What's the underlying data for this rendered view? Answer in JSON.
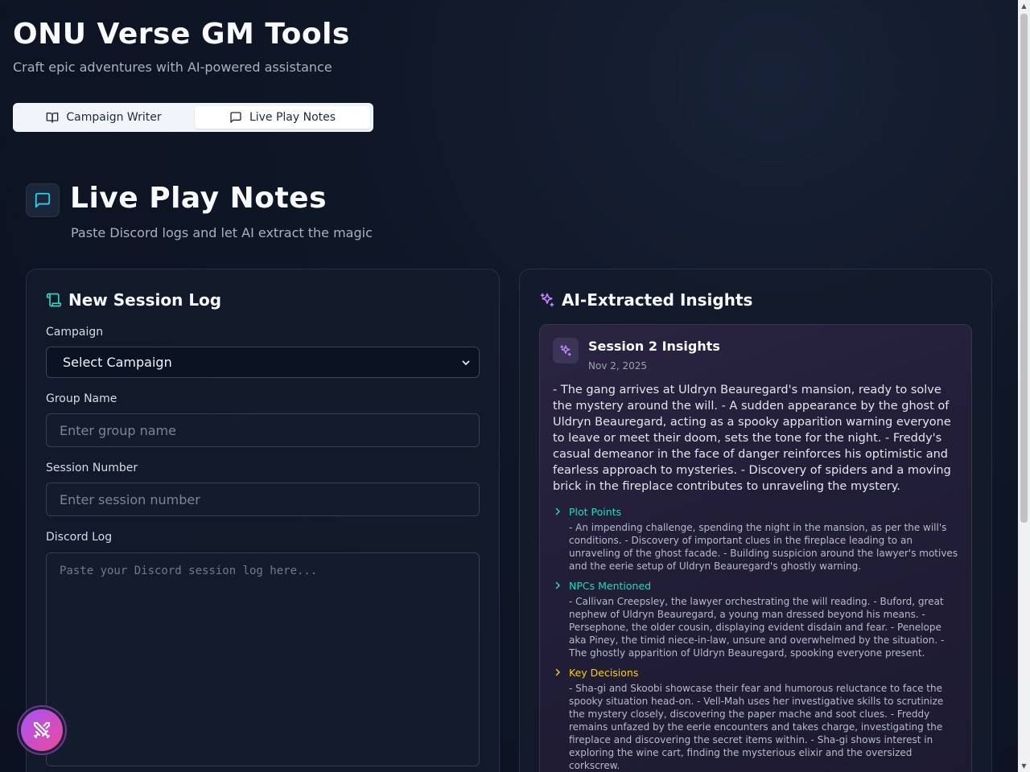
{
  "header": {
    "title": "ONU Verse GM Tools",
    "subtitle": "Craft epic adventures with AI-powered assistance"
  },
  "tabs": [
    {
      "label": "Campaign Writer",
      "icon": "book-open-icon",
      "active": false
    },
    {
      "label": "Live Play Notes",
      "icon": "message-square-icon",
      "active": true
    }
  ],
  "section": {
    "title": "Live Play Notes",
    "subtitle": "Paste Discord logs and let AI extract the magic",
    "icon": "message-square-icon"
  },
  "form": {
    "heading": "New Session Log",
    "campaign_label": "Campaign",
    "campaign_selected": "Select Campaign",
    "group_label": "Group Name",
    "group_placeholder": "Enter group name",
    "session_label": "Session Number",
    "session_placeholder": "Enter session number",
    "log_label": "Discord Log",
    "log_placeholder": "Paste your Discord session log here..."
  },
  "insights": {
    "heading": "AI-Extracted Insights",
    "card": {
      "title": "Session 2 Insights",
      "date": "Nov 2, 2025",
      "summary": "- The gang arrives at Uldryn Beauregard's mansion, ready to solve the mystery around the will. - A sudden appearance by the ghost of Uldryn Beauregard, acting as a spooky apparition warning everyone to leave or meet their doom, sets the tone for the night. - Freddy's casual demeanor in the face of danger reinforces his optimistic and fearless approach to mysteries. - Discovery of spiders and a moving brick in the fireplace contributes to unraveling the mystery.",
      "sections": [
        {
          "label": "Plot Points",
          "color": "#2dd4bf",
          "text": "- An impending challenge, spending the night in the mansion, as per the will's conditions. - Discovery of important clues in the fireplace leading to an unraveling of the ghost facade. - Building suspicion around the lawyer's motives and the eerie setup of Uldryn Beauregard's ghostly warning."
        },
        {
          "label": "NPCs Mentioned",
          "color": "#2dd4bf",
          "text": "- Callivan Creepsley, the lawyer orchestrating the will reading. - Buford, great nephew of Uldryn Beauregard, a young man dressed beyond his means. - Persephone, the older cousin, displaying evident disdain and fear. - Penelope aka Piney, the timid niece-in-law, unsure and overwhelmed by the situation. - The ghostly apparition of Uldryn Beauregard, spooking everyone present."
        },
        {
          "label": "Key Decisions",
          "color": "#facc15",
          "text": "- Sha-gi and Skoobi showcase their fear and humorous reluctance to face the spooky situation head-on. - Vell-Mah uses her investigative skills to scrutinize the mystery closely, discovering the paper mache and soot clues. - Freddy remains unfazed by the eerie encounters and takes charge, investigating the fireplace and discovering the secret items within. - Sha-gi shows interest in exploring the wine cart, finding the mysterious elixir and the oversized corkscrew."
        }
      ]
    }
  },
  "fab": {
    "icon": "crossed-swords-icon"
  },
  "colors": {
    "accent_teal": "#2dd4bf",
    "accent_purple": "#a855f7",
    "accent_pink": "#ec4899",
    "accent_yellow": "#facc15"
  }
}
